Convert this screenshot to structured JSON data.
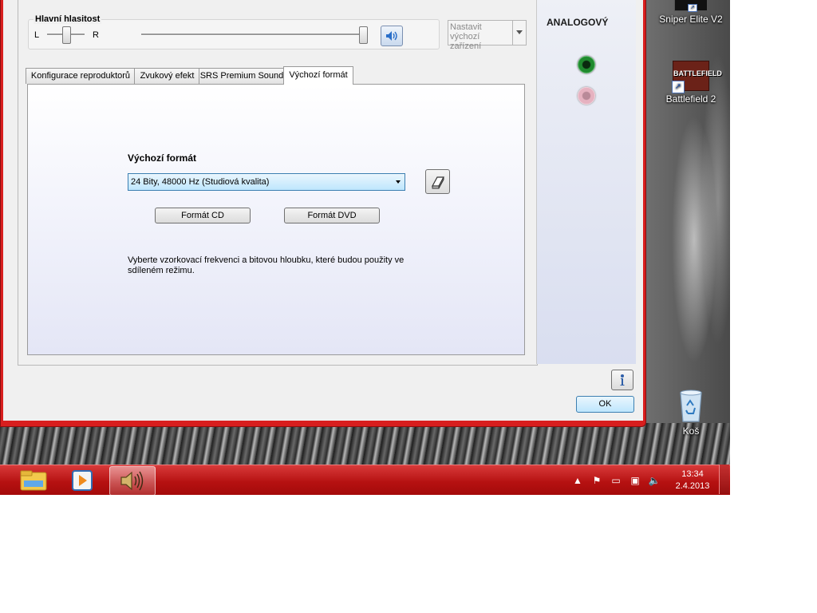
{
  "desktop": {
    "icons": [
      {
        "label": "Sniper Elite V2",
        "icon": "sniper-elite-icon"
      },
      {
        "label": "Battlefield 2",
        "icon": "battlefield-icon",
        "logo_text": "BATTLEFIELD"
      },
      {
        "label": "Koš",
        "icon": "recycle-bin-icon"
      }
    ]
  },
  "dialog": {
    "volume": {
      "title": "Hlavní hlasitost",
      "left_label": "L",
      "right_label": "R",
      "balance_level": 0.5,
      "volume_level": 1.0
    },
    "set_default": {
      "label": "Nastavit výchozí zařízení",
      "enabled": false
    },
    "tabs": [
      {
        "label": "Konfigurace reproduktorů",
        "active": false
      },
      {
        "label": "Zvukový efekt",
        "active": false
      },
      {
        "label": "SRS Premium Sound",
        "active": false
      },
      {
        "label": "Výchozí formát",
        "active": true
      }
    ],
    "panel": {
      "title": "Výchozí formát",
      "format_select": {
        "value": "24 Bity, 48000 Hz (Studiová kvalita)"
      },
      "cd_button": "Formát CD",
      "dvd_button": "Formát DVD",
      "description": "Vyberte vzorkovací frekvenci a bitovou hloubku, které budou použity ve sdíleném režimu."
    },
    "side": {
      "title": "ANALOGOVÝ",
      "jacks": [
        {
          "color": "#1f8a2e",
          "active": true
        },
        {
          "color": "#e6b2c0",
          "active": false
        }
      ]
    },
    "ok_button": "OK",
    "accent_color": "#d81e1e"
  },
  "taskbar": {
    "buttons": [
      {
        "icon": "file-explorer-icon",
        "active": false
      },
      {
        "icon": "media-player-icon",
        "active": false
      },
      {
        "icon": "speaker-icon",
        "active": true
      }
    ],
    "tray": [
      "show-hidden-icons-icon",
      "action-center-flag-icon",
      "power-icon",
      "network-icon",
      "volume-icon"
    ],
    "clock": {
      "time": "13:34",
      "date": "2.4.2013"
    },
    "color": "#c41a1a"
  }
}
